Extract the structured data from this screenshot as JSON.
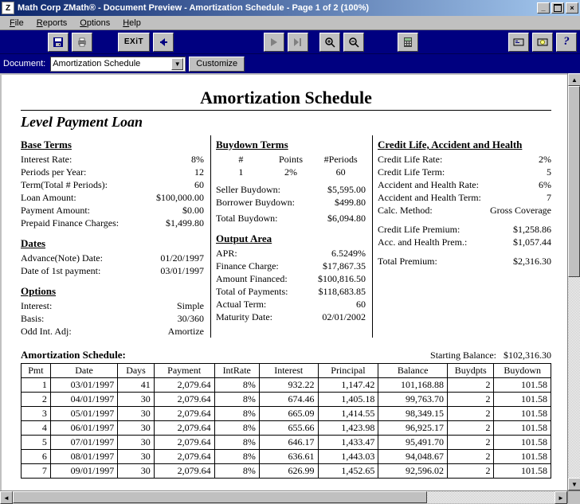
{
  "window": {
    "title": "Math Corp ZMath® - Document Preview - Amortization Schedule - Page  1 of  2  (100%)",
    "app_icon": "Z"
  },
  "menu": {
    "file": "File",
    "reports": "Reports",
    "options": "Options",
    "help": "Help"
  },
  "toolbar": {
    "save": "save",
    "print": "print",
    "exit_label": "EXiT",
    "back": "back",
    "first": "first",
    "play": "play",
    "end": "end",
    "zoom_in": "zoom-in",
    "zoom_out": "zoom-out",
    "calc": "calc",
    "tool_a": "tool-a",
    "tool_b": "tool-b",
    "help": "?",
    "doc_label": "Document:",
    "doc_selected": "Amortization Schedule",
    "customize": "Customize"
  },
  "doc": {
    "title": "Amortization Schedule",
    "subtitle": "Level Payment Loan",
    "base_terms": {
      "heading": "Base Terms",
      "interest_rate_k": "Interest Rate:",
      "interest_rate_v": "8%",
      "periods_per_year_k": "Periods per Year:",
      "periods_per_year_v": "12",
      "term_periods_k": "Term(Total # Periods):",
      "term_periods_v": "60",
      "loan_amount_k": "Loan Amount:",
      "loan_amount_v": "$100,000.00",
      "payment_amount_k": "Payment Amount:",
      "payment_amount_v": "$0.00",
      "prepaid_finance_k": "Prepaid Finance Charges:",
      "prepaid_finance_v": "$1,499.80"
    },
    "dates": {
      "heading": "Dates",
      "advance_k": "Advance(Note) Date:",
      "advance_v": "01/20/1997",
      "first_pmt_k": "Date of 1st payment:",
      "first_pmt_v": "03/01/1997"
    },
    "options": {
      "heading": "Options",
      "interest_k": "Interest:",
      "interest_v": "Simple",
      "basis_k": "Basis:",
      "basis_v": "30/360",
      "odd_int_k": "Odd Int. Adj:",
      "odd_int_v": "Amortize"
    },
    "buydown": {
      "heading": "Buydown Terms",
      "h_num": "#",
      "h_points": "Points",
      "h_periods": "#Periods",
      "r1_num": "1",
      "r1_points": "2%",
      "r1_periods": "60",
      "seller_k": "Seller Buydown:",
      "seller_v": "$5,595.00",
      "borrower_k": "Borrower Buydown:",
      "borrower_v": "$499.80",
      "total_k": "Total Buydown:",
      "total_v": "$6,094.80"
    },
    "output": {
      "heading": "Output Area",
      "apr_k": "APR:",
      "apr_v": "6.5249%",
      "fin_charge_k": "Finance Charge:",
      "fin_charge_v": "$17,867.35",
      "amt_fin_k": "Amount Financed:",
      "amt_fin_v": "$100,816.50",
      "total_pmts_k": "Total of Payments:",
      "total_pmts_v": "$118,683.85",
      "actual_term_k": "Actual Term:",
      "actual_term_v": "60",
      "maturity_k": "Maturity Date:",
      "maturity_v": "02/01/2002"
    },
    "credit": {
      "heading": "Credit Life, Accident and Health",
      "cl_rate_k": "Credit Life Rate:",
      "cl_rate_v": "2%",
      "cl_term_k": "Credit Life Term:",
      "cl_term_v": "5",
      "ah_rate_k": "Accident and Health Rate:",
      "ah_rate_v": "6%",
      "ah_term_k": "Accident and Health Term:",
      "ah_term_v": "7",
      "calc_k": "Calc. Method:",
      "calc_v": "Gross Coverage",
      "cl_prem_k": "Credit Life Premium:",
      "cl_prem_v": "$1,258.86",
      "ah_prem_k": "Acc. and Health Prem.:",
      "ah_prem_v": "$1,057.44",
      "total_prem_k": "Total Premium:",
      "total_prem_v": "$2,316.30"
    },
    "schedule": {
      "heading": "Amortization Schedule:",
      "starting_balance_label": "Starting Balance:",
      "starting_balance_value": "$102,316.30",
      "columns": [
        "Pmt",
        "Date",
        "Days",
        "Payment",
        "IntRate",
        "Interest",
        "Principal",
        "Balance",
        "Buydpts",
        "Buydown"
      ],
      "rows": [
        [
          "1",
          "03/01/1997",
          "41",
          "2,079.64",
          "8%",
          "932.22",
          "1,147.42",
          "101,168.88",
          "2",
          "101.58"
        ],
        [
          "2",
          "04/01/1997",
          "30",
          "2,079.64",
          "8%",
          "674.46",
          "1,405.18",
          "99,763.70",
          "2",
          "101.58"
        ],
        [
          "3",
          "05/01/1997",
          "30",
          "2,079.64",
          "8%",
          "665.09",
          "1,414.55",
          "98,349.15",
          "2",
          "101.58"
        ],
        [
          "4",
          "06/01/1997",
          "30",
          "2,079.64",
          "8%",
          "655.66",
          "1,423.98",
          "96,925.17",
          "2",
          "101.58"
        ],
        [
          "5",
          "07/01/1997",
          "30",
          "2,079.64",
          "8%",
          "646.17",
          "1,433.47",
          "95,491.70",
          "2",
          "101.58"
        ],
        [
          "6",
          "08/01/1997",
          "30",
          "2,079.64",
          "8%",
          "636.61",
          "1,443.03",
          "94,048.67",
          "2",
          "101.58"
        ],
        [
          "7",
          "09/01/1997",
          "30",
          "2,079.64",
          "8%",
          "626.99",
          "1,452.65",
          "92,596.02",
          "2",
          "101.58"
        ]
      ]
    }
  }
}
